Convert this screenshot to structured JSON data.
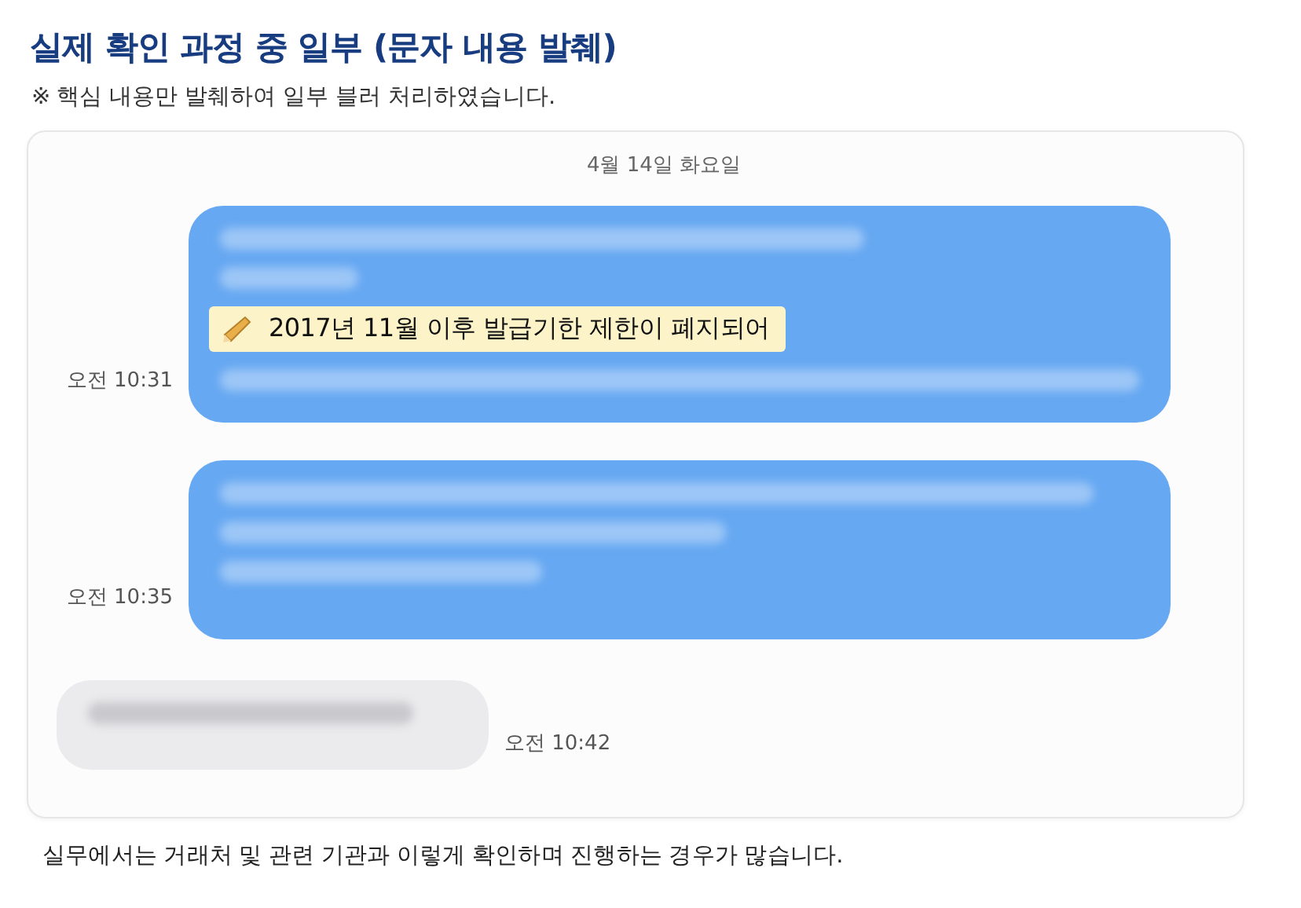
{
  "title": "실제 확인 과정 중 일부 (문자 내용 발췌)",
  "note": "※ 핵심 내용만 발췌하여 일부 블러 처리하였습니다.",
  "chat": {
    "date": "4월 14일 화요일",
    "messages": [
      {
        "kind": "sent",
        "time": "오전 10:31",
        "highlight": "2017년 11월 이후 발급기한 제한이 폐지되어"
      },
      {
        "kind": "sent",
        "time": "오전 10:35"
      },
      {
        "kind": "received",
        "time": "오전 10:42"
      }
    ]
  },
  "footer": "실무에서는 거래처 및 관련 기관과 이렇게 확인하며 진행하는 경우가 많습니다."
}
